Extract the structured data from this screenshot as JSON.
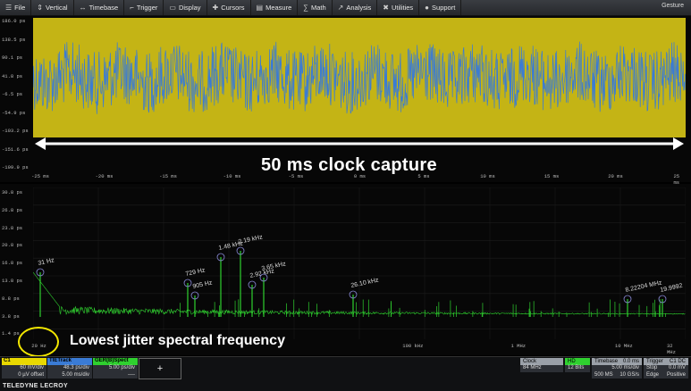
{
  "menu": [
    {
      "icon": "file-icon",
      "glyph": "☰",
      "label": "File"
    },
    {
      "icon": "vertical-icon",
      "glyph": "⇕",
      "label": "Vertical"
    },
    {
      "icon": "timebase-icon",
      "glyph": "↔",
      "label": "Timebase"
    },
    {
      "icon": "trigger-icon",
      "glyph": "⌐",
      "label": "Trigger"
    },
    {
      "icon": "display-icon",
      "glyph": "▭",
      "label": "Display"
    },
    {
      "icon": "cursors-icon",
      "glyph": "✚",
      "label": "Cursors"
    },
    {
      "icon": "measure-icon",
      "glyph": "▤",
      "label": "Measure"
    },
    {
      "icon": "math-icon",
      "glyph": "∑",
      "label": "Math"
    },
    {
      "icon": "analysis-icon",
      "glyph": "↗",
      "label": "Analysis"
    },
    {
      "icon": "utilities-icon",
      "glyph": "✖",
      "label": "Utilities"
    },
    {
      "icon": "support-icon",
      "glyph": "●",
      "label": "Support"
    }
  ],
  "gesture_label": "Gesture",
  "top_panel": {
    "y_ticks": [
      "186.0 ps",
      "138.5 ps",
      "90.1 ps",
      "41.8 ps",
      "-6.5 ps",
      "-54.9 ps",
      "-103.2 ps",
      "-151.6 ps",
      "-199.9 ps"
    ],
    "x_ticks": [
      "-25 ms",
      "-20 ms",
      "-15 ms",
      "-10 ms",
      "-5 ms",
      "0 ms",
      "5 ms",
      "10 ms",
      "15 ms",
      "20 ms",
      "25 ms"
    ],
    "trace_colors": {
      "background": "#c4b415",
      "trace": "#3a7bd5"
    },
    "caption": "50 ms clock capture"
  },
  "bottom_panel": {
    "y_ticks": [
      "30.8 ps",
      "26.8 ps",
      "23.8 ps",
      "20.8 ps",
      "16.8 ps",
      "13.8 ps",
      "8.8 ps",
      "3.8 ps",
      "1.4 ps"
    ],
    "x_ticks": [
      {
        "label": "20 Hz",
        "pos": 0.005
      },
      {
        "label": "100 kHz",
        "pos": 0.59
      },
      {
        "label": "1 MHz",
        "pos": 0.755
      },
      {
        "label": "10 MHz",
        "pos": 0.92
      },
      {
        "label": "32 MHz",
        "pos": 1.0
      }
    ],
    "peaks": [
      {
        "label": "31 Hz"
      },
      {
        "label": "729 Hz"
      },
      {
        "label": "905 Hz"
      },
      {
        "label": "1.48 kHz"
      },
      {
        "label": "2.19 kHz"
      },
      {
        "label": "2.92 kHz"
      },
      {
        "label": "3.65 kHz"
      },
      {
        "label": "26.10 kHz"
      },
      {
        "label": "8.22204 MHz"
      },
      {
        "label": "19.9992"
      }
    ],
    "trace_color": "#2fd02f",
    "annotation": "Lowest jitter spectral frequency"
  },
  "descriptors": [
    {
      "name": "C1",
      "color": "#e8d800",
      "line1": "60 mV/div",
      "line2": "0 µV offset"
    },
    {
      "name": "TIETrack",
      "color": "#3a7bd5",
      "line1": "48.3 ps/div",
      "line2": "5.00 ms/div"
    },
    {
      "name": "GER(B)Spect",
      "color": "#2fd02f",
      "line1": "5.00 ps/div",
      "line2": "----"
    }
  ],
  "add_label": "+",
  "logo": "TELEDYNE LECROY",
  "clock": {
    "head": "Clock",
    "value": "84 MHz"
  },
  "hd": {
    "head": "HD",
    "value": "12 Bits"
  },
  "timebase": {
    "head": "Timebase",
    "head_val": "0.0 ms",
    "r1a": "",
    "r1b": "5.00 ms/div",
    "r2a": "500 MS",
    "r2b": "10 GS/s"
  },
  "trigger": {
    "head": "Trigger",
    "head_val": "C1 DC",
    "r1a": "Stop",
    "r1b": "0.0 mV",
    "r2a": "Edge",
    "r2b": "Positive"
  }
}
